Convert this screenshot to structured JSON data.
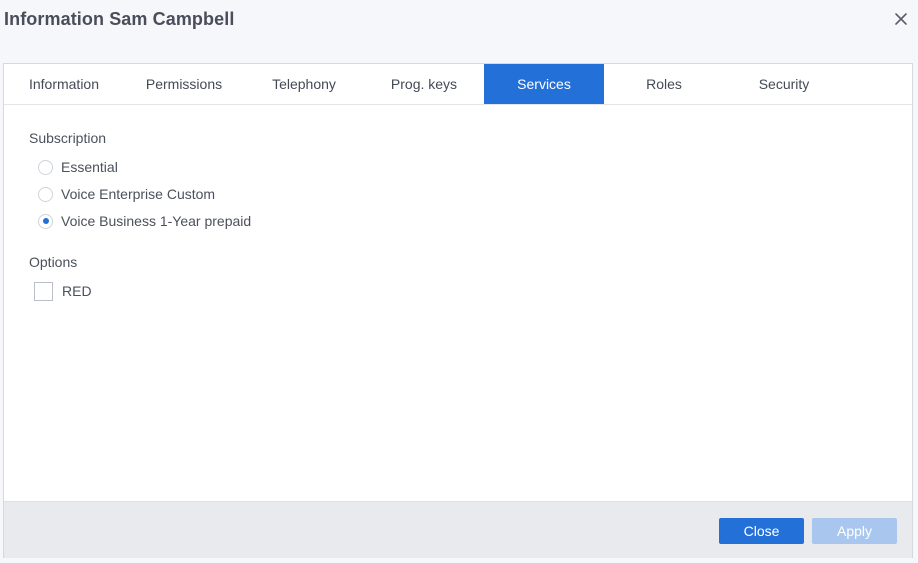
{
  "dialog": {
    "title": "Information Sam Campbell"
  },
  "tabs": [
    {
      "label": "Information",
      "active": false
    },
    {
      "label": "Permissions",
      "active": false
    },
    {
      "label": "Telephony",
      "active": false
    },
    {
      "label": "Prog. keys",
      "active": false
    },
    {
      "label": "Services",
      "active": true
    },
    {
      "label": "Roles",
      "active": false
    },
    {
      "label": "Security",
      "active": false
    }
  ],
  "subscription": {
    "label": "Subscription",
    "options": [
      {
        "label": "Essential",
        "checked": false
      },
      {
        "label": "Voice Enterprise Custom",
        "checked": false
      },
      {
        "label": "Voice Business 1-Year prepaid",
        "checked": true
      }
    ]
  },
  "options": {
    "label": "Options",
    "items": [
      {
        "label": "RED",
        "checked": false
      }
    ]
  },
  "footer": {
    "close_label": "Close",
    "apply_label": "Apply"
  },
  "colors": {
    "accent": "#2470d9",
    "apply_disabled": "#a9c7ee",
    "footer_bg": "#e9eaee"
  },
  "icons": {
    "close": "close-icon"
  }
}
